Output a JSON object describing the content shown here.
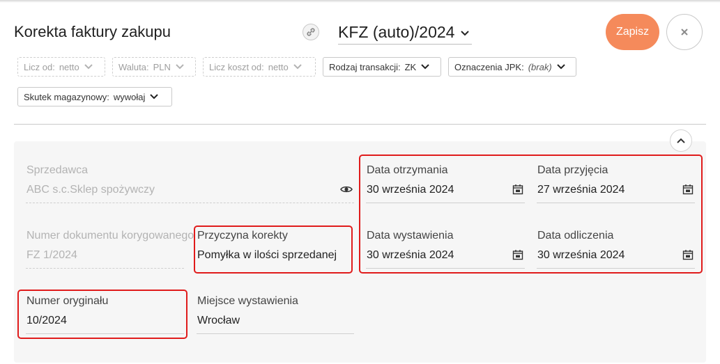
{
  "header": {
    "title": "Korekta faktury zakupu",
    "document_number": "KFZ (auto)/2024",
    "save_label": "Zapisz"
  },
  "options": [
    {
      "label": "Licz od:",
      "value": "netto",
      "enabled": false
    },
    {
      "label": "Waluta:",
      "value": "PLN",
      "enabled": false
    },
    {
      "label": "Licz koszt od:",
      "value": "netto",
      "enabled": false
    },
    {
      "label": "Rodzaj transakcji:",
      "value": "ZK",
      "enabled": true
    },
    {
      "label": "Oznaczenia JPK:",
      "value": "(brak)",
      "enabled": true
    },
    {
      "label": "Skutek magazynowy:",
      "value": "wywołaj",
      "enabled": true
    }
  ],
  "form": {
    "seller": {
      "label": "Sprzedawca",
      "value": "ABC s.c.Sklep spożywczy"
    },
    "corrected_doc": {
      "label": "Numer dokumentu korygowanego",
      "value": "FZ 1/2024"
    },
    "reason": {
      "label": "Przyczyna korekty",
      "value": "Pomyłka w ilości sprzedanej"
    },
    "original_number": {
      "label": "Numer oryginału",
      "value": "10/2024"
    },
    "place": {
      "label": "Miejsce wystawienia",
      "value": "Wrocław"
    },
    "received_date": {
      "label": "Data otrzymania",
      "value": "30 września 2024"
    },
    "accepted_date": {
      "label": "Data przyjęcia",
      "value": "27 września 2024"
    },
    "issue_date": {
      "label": "Data wystawienia",
      "value": "30 września 2024"
    },
    "deduction_date": {
      "label": "Data odliczenia",
      "value": "30 września 2024"
    }
  },
  "icons": [
    "link-icon",
    "chevron-down-icon",
    "close-icon",
    "chevron-up-icon",
    "eye-icon",
    "calendar-icon"
  ],
  "colors": {
    "accent": "#f58a5b",
    "highlight": "#e01b1b"
  }
}
